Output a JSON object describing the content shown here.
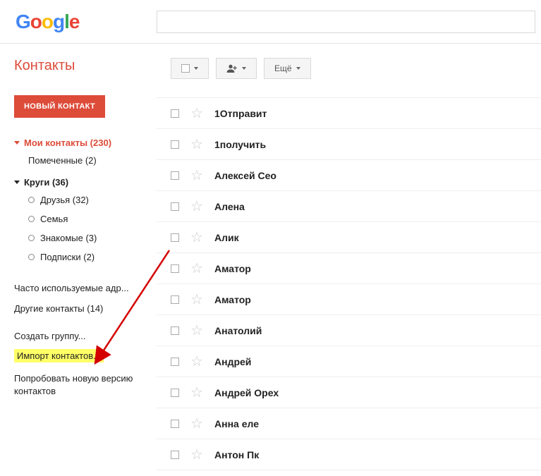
{
  "search_placeholder": "",
  "page_title": "Контакты",
  "new_button": "НОВЫЙ КОНТАКТ",
  "more_label": "Ещё",
  "sidebar": {
    "my_contacts": "Мои контакты (230)",
    "starred": "Помеченные (2)",
    "circles": "Круги (36)",
    "circle_items": [
      "Друзья (32)",
      "Семья",
      "Знакомые (3)",
      "Подписки (2)"
    ],
    "links": {
      "frequent": "Часто используемые адр...",
      "other": "Другие контакты (14)",
      "create_group": "Создать группу...",
      "import": "Импорт контактов...",
      "try_new": "Попробовать новую версию контактов"
    }
  },
  "contacts": [
    "1Отправит",
    "1получить",
    "Алексей Сео",
    "Алена",
    "Алик",
    "Аматор",
    "Аматор",
    "Анатолий",
    "Андрей",
    "Андрей Орех",
    "Анна еле",
    "Антон Пк"
  ]
}
